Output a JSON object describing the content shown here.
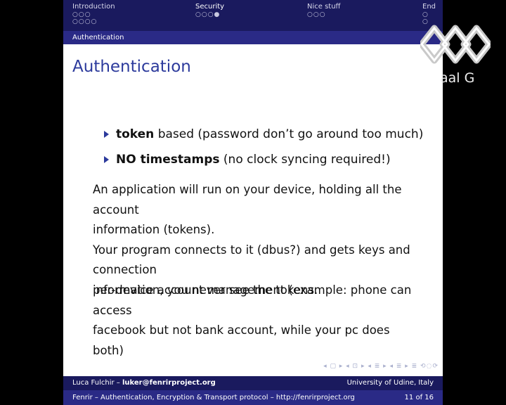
{
  "nav": {
    "sections": [
      {
        "title": "Introduction",
        "dots_row1": "○○○",
        "dots_row2": "○○○○"
      },
      {
        "title": "Security",
        "dots_row1": "○○○●",
        "dots_row2": ""
      },
      {
        "title": "Nice stuff",
        "dots_row1": "○○○",
        "dots_row2": ""
      },
      {
        "title": "End",
        "dots_row1": "○",
        "dots_row2": "○"
      }
    ],
    "subsection": "Authentication"
  },
  "frame": {
    "title": "Authentication",
    "bullets": [
      {
        "bold": "token",
        "rest": " based (password don’t go around too much)"
      },
      {
        "bold": "NO timestamps",
        "rest": " (no clock syncing required!)"
      }
    ],
    "paragraph1_line1": "An application will run on your device, holding all the account",
    "paragraph1_line2": "information (tokens).",
    "paragraph1_line3": "Your program connects to it (dbus?) and gets keys and connection",
    "paragraph1_line4": "information, you never see the tokens.",
    "paragraph2_line1": "per-device account management (example: phone can access",
    "paragraph2_line2": "facebook but not bank account, while your pc does both)"
  },
  "navigation_symbols": "◂ ▢ ▸ ◂ ⊡ ▸ ◂ ≣ ▸ ◂ ≣ ▸ ≣ ⟲◌⟳",
  "footer": {
    "author": "Luca Fulchir –",
    "email": "luker@fenrirproject.org",
    "institution": "University of Udine, Italy",
    "talk_title": "Fenrir – Authentication, Encryption & Transport protocol – http://fenrirproject.org",
    "page": "11 of 16"
  },
  "logo": {
    "text": "aal G"
  }
}
